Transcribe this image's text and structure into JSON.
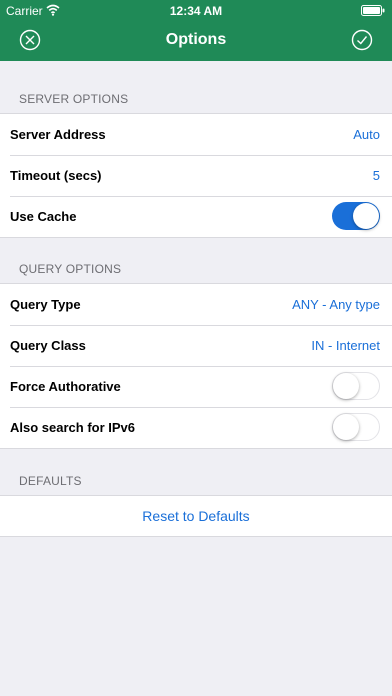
{
  "status": {
    "carrier": "Carrier",
    "time": "12:34 AM"
  },
  "nav": {
    "title": "Options"
  },
  "server": {
    "header": "SERVER OPTIONS",
    "address_label": "Server Address",
    "address_value": "Auto",
    "timeout_label": "Timeout (secs)",
    "timeout_value": "5",
    "cache_label": "Use Cache",
    "cache_on": true
  },
  "query": {
    "header": "QUERY OPTIONS",
    "type_label": "Query Type",
    "type_value": "ANY - Any type",
    "class_label": "Query Class",
    "class_value": "IN - Internet",
    "force_label": "Force Authorative",
    "force_on": false,
    "ipv6_label": "Also search for IPv6",
    "ipv6_on": false
  },
  "defaults": {
    "header": "DEFAULTS",
    "reset_label": "Reset to Defaults"
  },
  "colors": {
    "header_bg": "#1f8a57",
    "accent": "#1a6fd8"
  }
}
